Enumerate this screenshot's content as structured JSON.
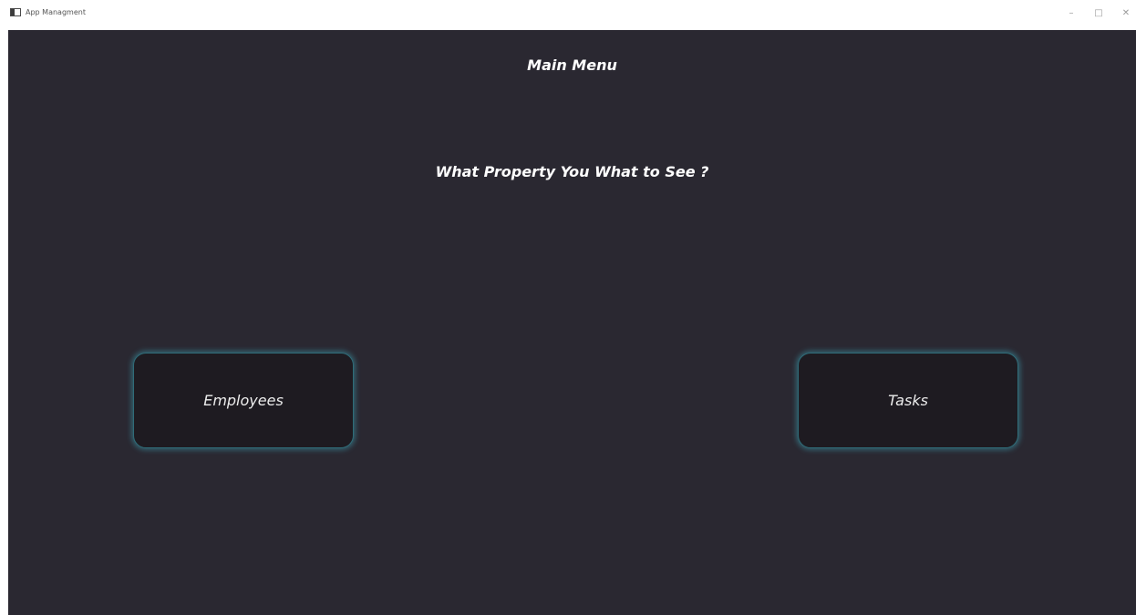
{
  "window": {
    "title": "App Managment",
    "controls": {
      "minimize": "–",
      "maximize": "□",
      "close": "✕"
    }
  },
  "main": {
    "title": "Main Menu",
    "question": "What Property You What to See ?",
    "buttons": {
      "employees": "Employees",
      "tasks": "Tasks"
    }
  },
  "colors": {
    "background": "#2a2831",
    "button_bg": "#1e1b21",
    "button_glow": "#40aabe",
    "text": "#ffffff"
  }
}
